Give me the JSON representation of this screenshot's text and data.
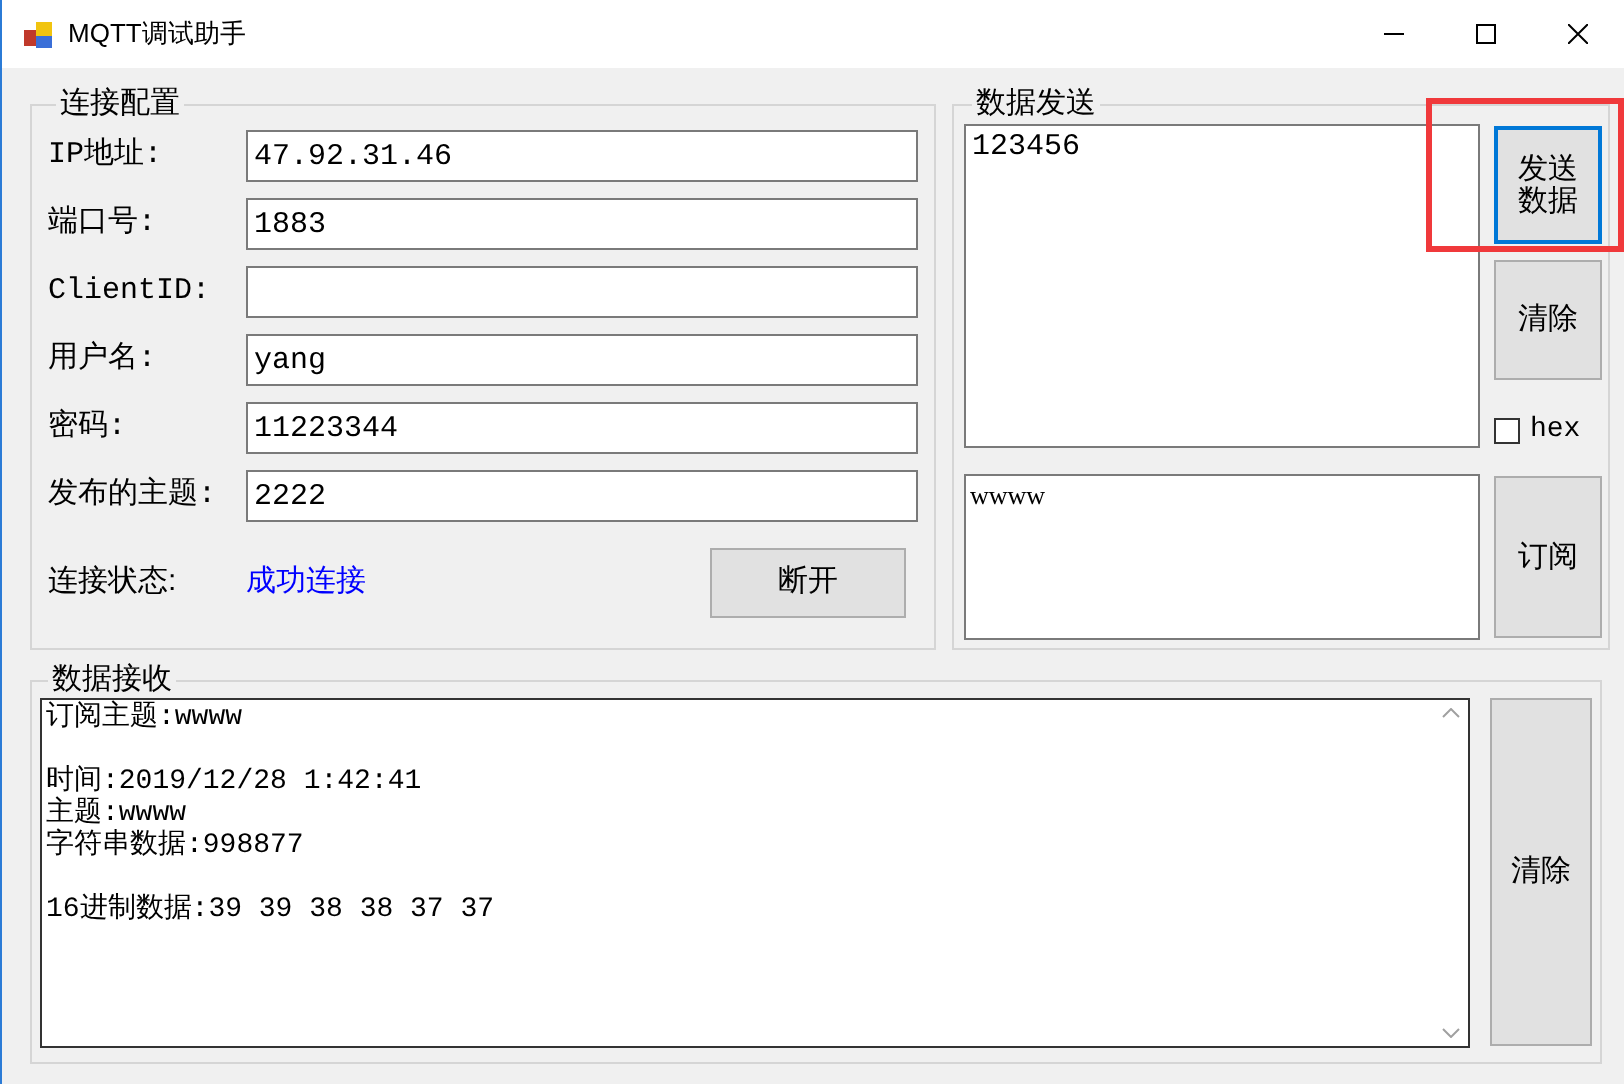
{
  "window": {
    "title": "MQTT调试助手"
  },
  "connection": {
    "title": "连接配置",
    "fields": [
      {
        "label": "IP地址:",
        "value": "47.92.31.46"
      },
      {
        "label": "端口号:",
        "value": "1883"
      },
      {
        "label": "ClientID:"
      },
      {
        "label": "用户名:",
        "value": "yang"
      },
      {
        "label": "密码:",
        "value": "11223344"
      },
      {
        "label": "发布的主题:",
        "value": "2222"
      }
    ],
    "status_label": "连接状态:",
    "status_value": "成功连接",
    "disconnect_button": "断开"
  },
  "send": {
    "title": "数据发送",
    "message": "123456",
    "send_button": {
      "label": "发送数据",
      "focused": true,
      "highlighted": true
    },
    "clear_button": {
      "label": "清除",
      "focused": false,
      "highlighted": false
    },
    "hex": {
      "label": "hex",
      "checked": false
    },
    "topic": "wwww",
    "subscribe_button": {
      "label": "订阅",
      "focused": false,
      "highlighted": false
    }
  },
  "receive": {
    "title": "数据接收",
    "paragraphs": [
      [
        "订阅主题:wwww"
      ],
      [
        "时间:2019/12/28 1:42:41",
        "主题:wwww",
        "字符串数据:998877"
      ],
      [
        "16进制数据:39 39 38 38 37 37"
      ]
    ],
    "clear_button": "清除"
  }
}
